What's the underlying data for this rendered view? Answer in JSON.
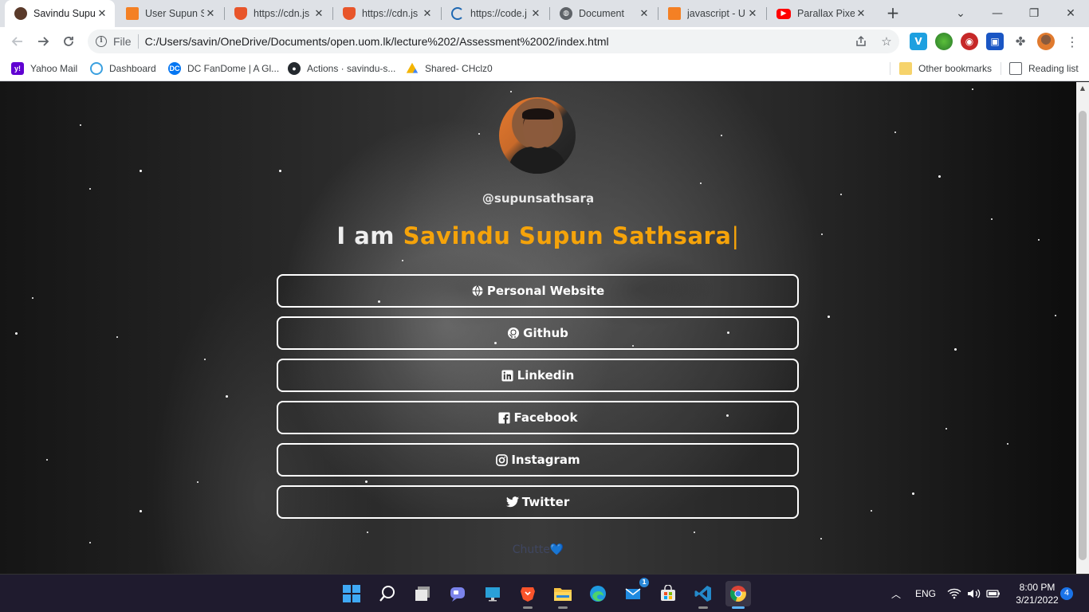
{
  "browser": {
    "tabs": [
      {
        "label": "Savindu Supu",
        "active": true,
        "icon": "avatar-favicon"
      },
      {
        "label": "User Supun S",
        "active": false,
        "icon": "stackoverflow-icon"
      },
      {
        "label": "https://cdn.js",
        "active": false,
        "icon": "brave-shield-icon"
      },
      {
        "label": "https://cdn.js",
        "active": false,
        "icon": "brave-shield-icon"
      },
      {
        "label": "https://code.j",
        "active": false,
        "icon": "jquery-icon"
      },
      {
        "label": "Document",
        "active": false,
        "icon": "globe-icon"
      },
      {
        "label": "javascript - U",
        "active": false,
        "icon": "stackoverflow-icon"
      },
      {
        "label": "Parallax Pixel",
        "active": false,
        "icon": "youtube-icon"
      }
    ],
    "tab_close": "✕",
    "new_tab": "+",
    "window": {
      "minimize": "—",
      "maximize": "❐",
      "close": "✕",
      "tab_search": "⌄"
    },
    "toolbar": {
      "scheme": "File",
      "url": "C:/Users/savin/OneDrive/Documents/open.uom.lk/lecture%202/Assessment%2002/index.html"
    },
    "bookmarks": [
      {
        "label": "Yahoo Mail",
        "icon": "yahoo-icon",
        "color": "#6001d2"
      },
      {
        "label": "Dashboard",
        "icon": "dashboard-icon",
        "color": "#3aa0e0"
      },
      {
        "label": "DC FanDome | A Gl...",
        "icon": "dc-icon",
        "color": "#0476f2"
      },
      {
        "label": "Actions · savindu-s...",
        "icon": "github-icon",
        "color": "#24292e"
      },
      {
        "label": "Shared- CHclz0",
        "icon": "google-drive-icon",
        "color": "#f4b400"
      }
    ],
    "other_bookmarks": "Other bookmarks",
    "reading_list": "Reading list"
  },
  "page": {
    "handle": "@supunsathsara",
    "headline_prefix": "I am ",
    "headline_name": "Savindu Supun Sathsara",
    "caret": "|",
    "links": [
      {
        "label": "Personal Website",
        "icon": "globe-icon"
      },
      {
        "label": "Github",
        "icon": "github-icon"
      },
      {
        "label": "Linkedin",
        "icon": "linkedin-icon"
      },
      {
        "label": "Facebook",
        "icon": "facebook-icon"
      },
      {
        "label": "Instagram",
        "icon": "instagram-icon"
      },
      {
        "label": "Twitter",
        "icon": "twitter-icon"
      }
    ],
    "footer": "Chutte💙",
    "accent_color": "#f5a30a"
  },
  "taskbar": {
    "language": "ENG",
    "time": "8:00 PM",
    "date": "3/21/2022",
    "notifications": "4",
    "mail_badge": "1"
  }
}
